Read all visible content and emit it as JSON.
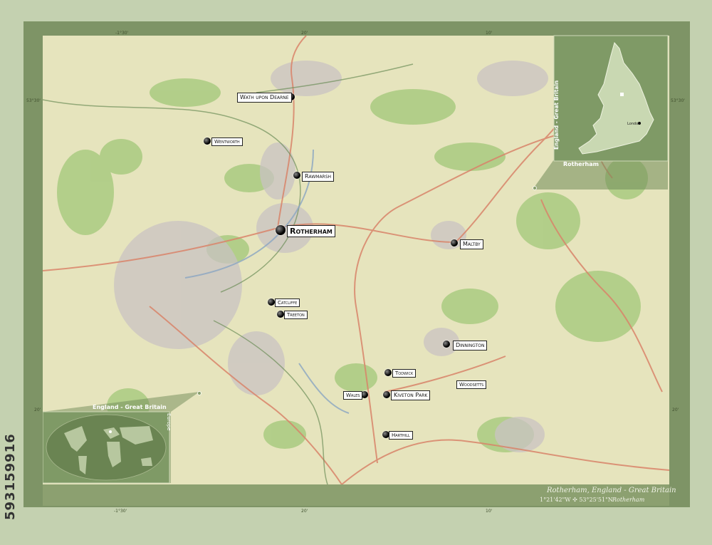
{
  "places": [
    {
      "name": "Wath upon Dearne",
      "size": "mid"
    },
    {
      "name": "Wentworth",
      "size": "small"
    },
    {
      "name": "Rawmarsh",
      "size": "mid"
    },
    {
      "name": "Rotherham",
      "size": "big"
    },
    {
      "name": "Maltby",
      "size": "mid"
    },
    {
      "name": "Catcliffe",
      "size": "small"
    },
    {
      "name": "Treeton",
      "size": "small"
    },
    {
      "name": "Dinnington",
      "size": "mid"
    },
    {
      "name": "Todwick",
      "size": "small"
    },
    {
      "name": "Woodsetts",
      "size": "small"
    },
    {
      "name": "Wales",
      "size": "small"
    },
    {
      "name": "Kiveton Park",
      "size": "mid"
    },
    {
      "name": "Harthill",
      "size": "small"
    }
  ],
  "graticule": {
    "top_lon_left": "-1°30'",
    "top_lon_mid": "20'",
    "top_lon_right": "10'",
    "lat_top": "53°30'",
    "lat_bottom": "20'",
    "bottom_lon_left": "-1°30'",
    "bottom_lon_mid": "20'",
    "bottom_lon_right": "10'"
  },
  "inset_country": {
    "title": "England - Great Britain",
    "region_label": "Rotherham",
    "city": "London"
  },
  "inset_world": {
    "title": "England - Great Britain",
    "continent": "Europe"
  },
  "caption": {
    "title": "Rotherham, England - Great Britain",
    "coords": "1°21'42\"W  ✣  53°25'51\"N",
    "region": "Rotherham"
  },
  "watermark": "593159916",
  "colors": {
    "frame": "#7e9466",
    "map_bg": "#e6e4bd",
    "green": "#8fbf6a",
    "road": "#d9846a"
  }
}
